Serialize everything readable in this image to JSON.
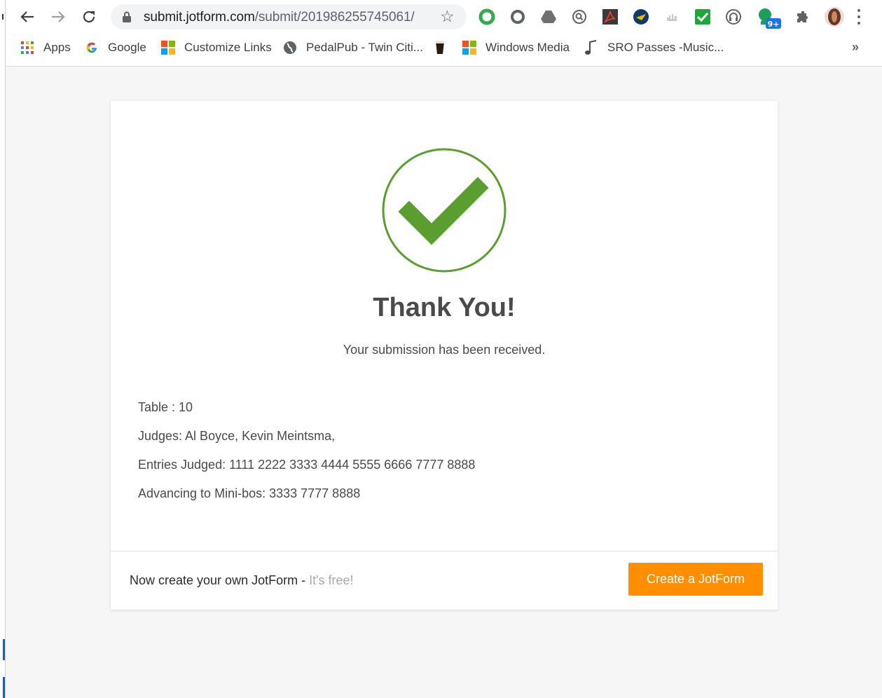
{
  "browser": {
    "url_host": "submit.jotform.com",
    "url_path": "/submit/201986255745061/",
    "bookmarks": [
      {
        "label": "Apps",
        "icon": "apps-grid-icon"
      },
      {
        "label": "Google",
        "icon": "google-g-icon"
      },
      {
        "label": "Customize Links",
        "icon": "microsoft-logo-icon"
      },
      {
        "label": "PedalPub - Twin Citi...",
        "icon": "globe-icon"
      },
      {
        "label": "",
        "icon": "pint-glass-icon"
      },
      {
        "label": "Windows Media",
        "icon": "microsoft-logo-icon"
      },
      {
        "label": "SRO Passes -Music...",
        "icon": "music-note-icon"
      }
    ],
    "extension_badge": "9+"
  },
  "page": {
    "title": "Thank You!",
    "subtitle": "Your submission has been received.",
    "details": [
      "Table : 10",
      "Judges: Al Boyce, Kevin Meintsma,",
      "Entries Judged: 1111 2222 3333 4444 5555 6666 7777 8888",
      "Advancing to Mini-bos: 3333 7777 8888"
    ],
    "footer": {
      "text": "Now create your own JotForm -",
      "free_text": "It's free!",
      "button_label": "Create a JotForm"
    }
  },
  "colors": {
    "check_green": "#5a9e2f",
    "cta_orange": "#ff8f00"
  }
}
